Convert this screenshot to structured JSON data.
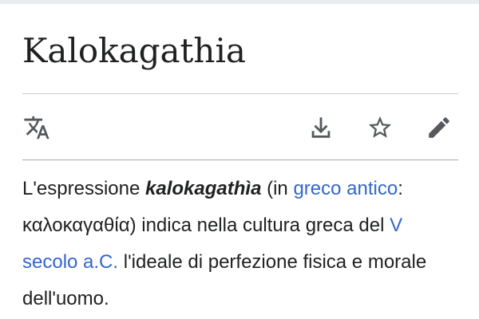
{
  "article": {
    "title": "Kalokagathia"
  },
  "actions": {
    "translate_icon": "translate-icon",
    "download_icon": "download-icon",
    "star_icon": "star-icon",
    "edit_icon": "pencil-icon"
  },
  "content": {
    "p1_text_a": "L'espressione ",
    "p1_bold": "kalokagathìa",
    "p1_text_b": " (in ",
    "p1_link_greek": "greco antico",
    "p1_text_c": ": καλοκαγαθία) indica nella cultura greca del ",
    "p1_link_century": "V secolo a.C.",
    "p1_text_d": " l'ideale di perfezione fisica e morale dell'uomo."
  },
  "colors": {
    "text": "#202122",
    "link": "#3366cc",
    "icon": "#54595d"
  }
}
